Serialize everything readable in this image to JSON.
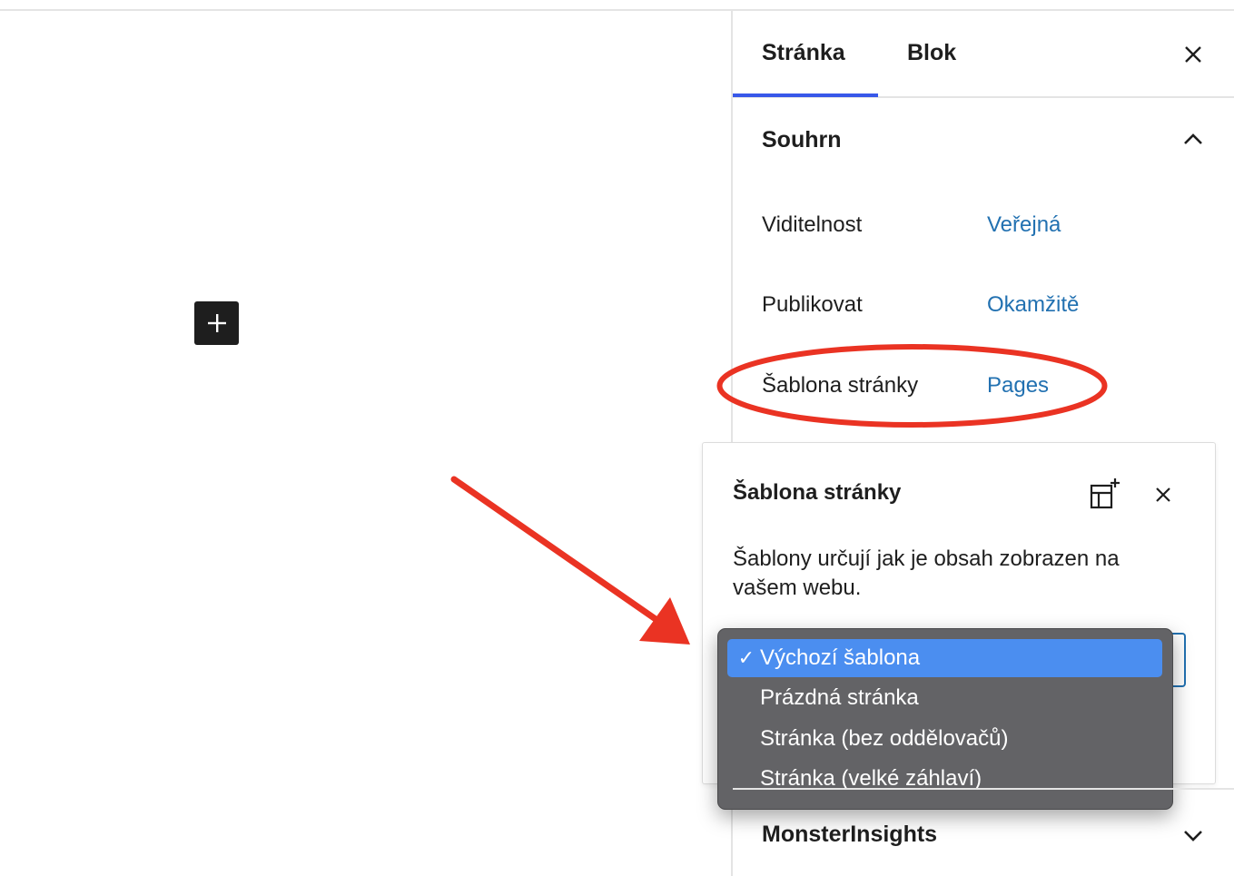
{
  "sidebar": {
    "tabs": [
      {
        "label": "Stránka",
        "active": true
      },
      {
        "label": "Blok",
        "active": false
      }
    ],
    "close_icon": "close-icon",
    "summary": {
      "title": "Souhrn",
      "rows": [
        {
          "label": "Viditelnost",
          "value": "Veřejná"
        },
        {
          "label": "Publikovat",
          "value": "Okamžitě"
        },
        {
          "label": "Šablona stránky",
          "value": "Pages"
        }
      ]
    },
    "monsterinsights": {
      "title": "MonsterInsights"
    }
  },
  "editor": {
    "add_block_icon": "plus-icon"
  },
  "template_popover": {
    "title": "Šablona stránky",
    "description": "Šablony určují jak je obsah zobrazen na vašem webu.",
    "add_template_icon": "add-template-icon",
    "close_icon": "close-icon",
    "dropdown": {
      "options": [
        {
          "label": "Výchozí šablona",
          "selected": true,
          "check": "✓"
        },
        {
          "label": "Prázdná stránka",
          "selected": false,
          "check": ""
        },
        {
          "label": "Stránka (bez oddělovačů)",
          "selected": false,
          "check": ""
        },
        {
          "label": "Stránka (velké záhlaví)",
          "selected": false,
          "check": ""
        }
      ]
    }
  },
  "colors": {
    "accent": "#3858e9",
    "link": "#2271b1",
    "annotation": "#ea3323",
    "dropdown_bg": "#636366",
    "dropdown_selected": "#4b8ef0"
  }
}
